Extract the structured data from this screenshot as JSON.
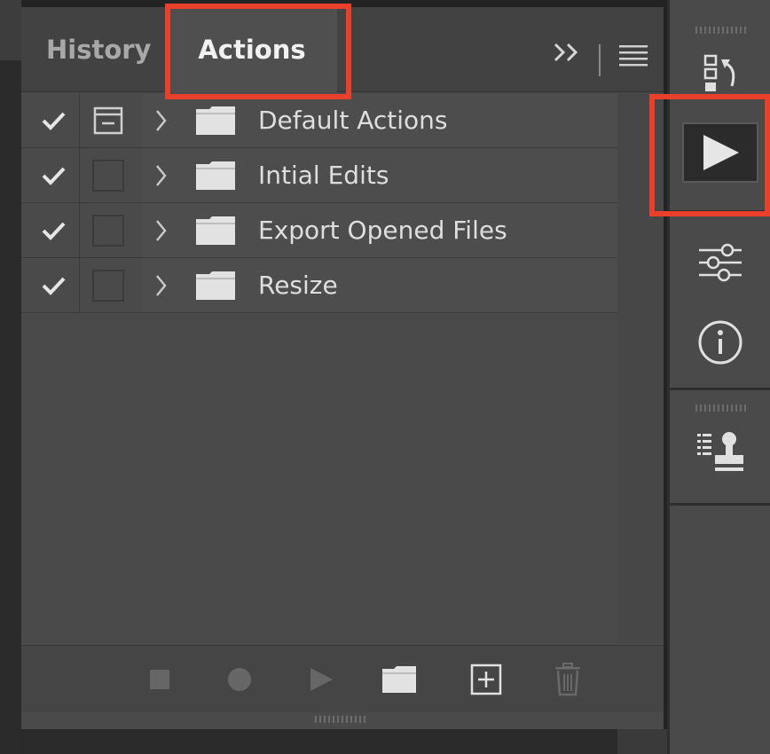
{
  "panel": {
    "tabs": [
      {
        "label": "History",
        "active": false
      },
      {
        "label": "Actions",
        "active": true
      }
    ]
  },
  "actions": [
    {
      "label": "Default Actions",
      "checked": true,
      "dialog": true,
      "icon": "folder-icon"
    },
    {
      "label": "Intial Edits",
      "checked": true,
      "dialog": false,
      "icon": "folder-icon"
    },
    {
      "label": "Export Opened Files",
      "checked": true,
      "dialog": false,
      "icon": "folder-icon"
    },
    {
      "label": "Resize",
      "checked": true,
      "dialog": false,
      "icon": "folder-icon"
    }
  ],
  "footer_buttons": [
    "stop-icon",
    "record-icon",
    "play-icon",
    "folder-icon",
    "new-action-icon",
    "trash-icon"
  ],
  "dock_icons": [
    "history-icon",
    "actions-play-icon",
    "adjustments-icon",
    "info-icon",
    "clone-source-icon"
  ],
  "colors": {
    "highlight": "#e8402a",
    "panel": "#4a4a4a",
    "header": "#424242",
    "text": "#dedede"
  }
}
